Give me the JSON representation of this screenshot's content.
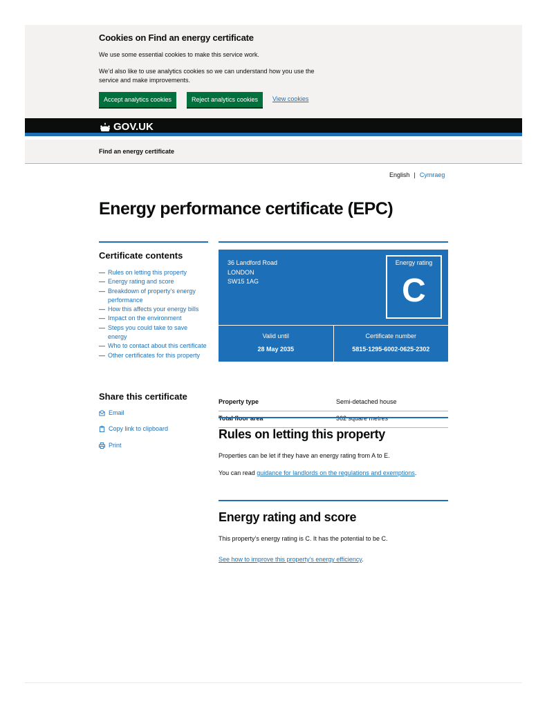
{
  "cookie_banner": {
    "title": "Cookies on Find an energy certificate",
    "p1": "We use some essential cookies to make this service work.",
    "p2": "We’d also like to use analytics cookies so we can understand how you use the service and make improvements.",
    "accept": "Accept analytics cookies",
    "reject": "Reject analytics cookies",
    "view": "View cookies"
  },
  "header": {
    "logo": "GOV.UK",
    "service": "Find an energy certificate"
  },
  "language": {
    "english": "English",
    "separator": "|",
    "welsh": "Cymraeg"
  },
  "page_title": "Energy performance certificate (EPC)",
  "contents": {
    "title": "Certificate contents",
    "items": [
      "Rules on letting this property",
      "Energy rating and score",
      "Breakdown of property’s energy performance",
      "How this affects your energy bills",
      "Impact on the environment",
      "Steps you could take to save energy",
      "Who to contact about this certificate",
      "Other certificates for this property"
    ]
  },
  "share": {
    "title": "Share this certificate",
    "email": "Email",
    "copy": "Copy link to clipboard",
    "print": "Print"
  },
  "certificate": {
    "address": [
      "36 Landford Road",
      "LONDON",
      "SW15 1AG"
    ],
    "rating_label": "Energy rating",
    "rating": "C",
    "valid_label": "Valid until",
    "valid_value": "28 May 2035",
    "number_label": "Certificate number",
    "number_value": "5815-1295-6002-0625-2302",
    "accent_color": "#1d70b8"
  },
  "summary": [
    {
      "key": "Property type",
      "value": "Semi-detached house"
    },
    {
      "key": "Total floor area",
      "value": "362 square metres"
    }
  ],
  "rules": {
    "title": "Rules on letting this property",
    "p1": "Properties can be let if they have an energy rating from A to E.",
    "p2_prefix": "You can read ",
    "p2_link": "guidance for landlords on the regulations and exemptions",
    "p2_suffix": "."
  },
  "energy": {
    "title": "Energy rating and score",
    "p1": "This property’s energy rating is C. It has the potential to be C.",
    "link": "See how to improve this property’s energy efficiency",
    "link_suffix": "."
  }
}
